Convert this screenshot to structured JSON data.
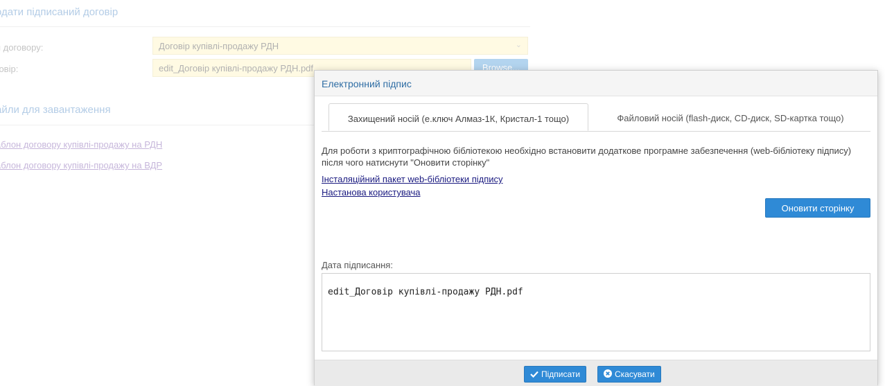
{
  "background": {
    "title": "одати підписаний договір",
    "type_label": "п договору:",
    "type_value": "Договір купівлі-продажу РДН",
    "file_label": "говір:",
    "file_value": "edit_Договір купівлі-продажу РДН.pdf",
    "browse_label": "Browse...",
    "section_title": "айли для завантаження",
    "links": [
      "аблон договору купівлі-продажу на РДН",
      "аблон договору купівлі-продажу на ВДР"
    ]
  },
  "dialog": {
    "title": "Електронний підпис",
    "tabs": [
      {
        "label": "Захищений носій (е.ключ Алмаз-1К, Кристал-1 тощо)",
        "active": true
      },
      {
        "label": "Файловий носій (flash-диск, CD-диск, SD-картка тощо)",
        "active": false
      }
    ],
    "description": "Для роботи з криптографічною бібліотекою необхідно встановити додаткове програмне забезпечення (web-бібліотеку підпису) після чого натиснути \"Оновити сторінку\"",
    "links": [
      "Інсталяційний пакет web-бібліотеки підпису",
      "Настанова користувача"
    ],
    "refresh_label": "Оновити сторінку",
    "date_label": "Дата підписання:",
    "sign_text": "edit_Договір купівлі-продажу РДН.pdf",
    "sign_button": "Підписати",
    "cancel_button": "Скасувати"
  },
  "icons": {
    "sign": "check-icon",
    "cancel": "times-circle-icon",
    "select": "chevron-down-icon"
  },
  "colors": {
    "accent": "#2f8ad6",
    "field_highlight": "#fff3b8",
    "title_blue": "#2e6da4"
  }
}
